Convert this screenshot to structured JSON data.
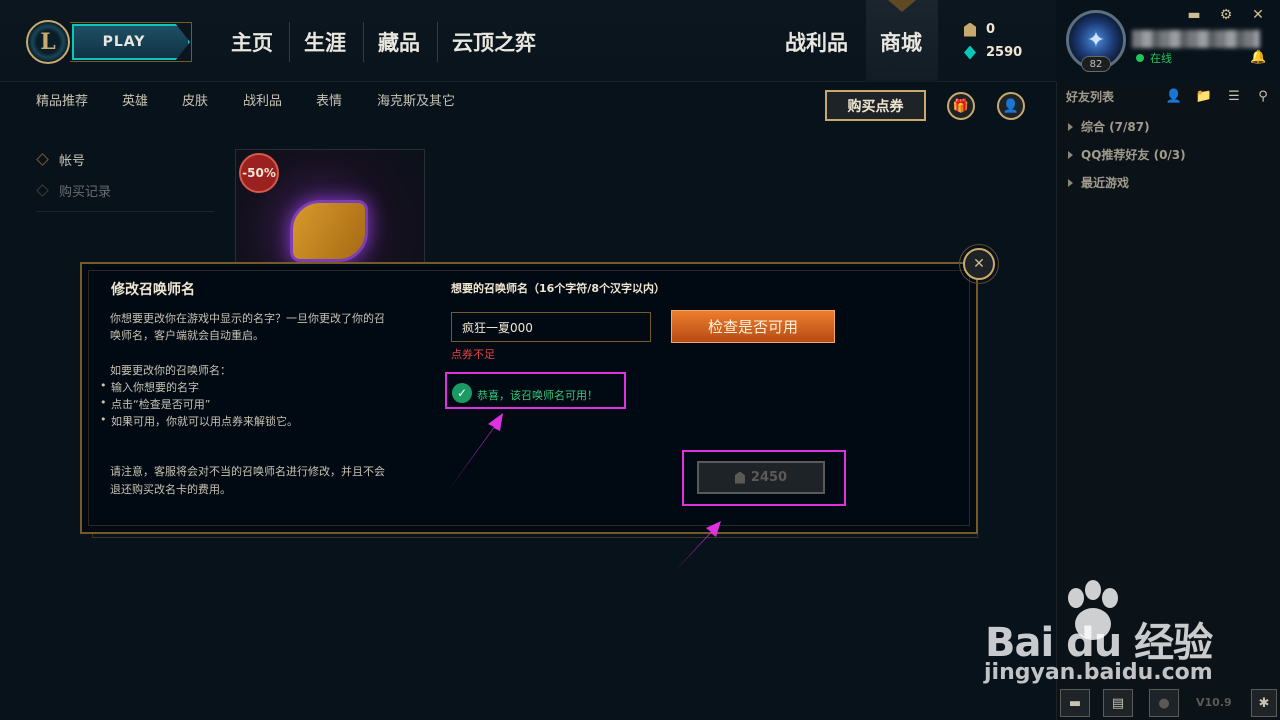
{
  "header": {
    "play_label": "PLAY",
    "nav": [
      {
        "label": "主页"
      },
      {
        "label": "生涯"
      },
      {
        "label": "藏品"
      },
      {
        "label": "云顶之弈"
      }
    ],
    "loot_label": "战利品",
    "store_label": "商城",
    "currency": {
      "rp": "0",
      "blue_essence": "2590"
    },
    "profile": {
      "level": "82",
      "status": "在线"
    }
  },
  "subnav": {
    "items": [
      "精品推荐",
      "英雄",
      "皮肤",
      "战利品",
      "表情",
      "海克斯及其它"
    ],
    "buy_rp_label": "购买点券"
  },
  "side_menu": {
    "items": [
      "帐号",
      "购买记录"
    ]
  },
  "product": {
    "discount": "-50%"
  },
  "friends": {
    "title": "好友列表",
    "groups": [
      {
        "label": "综合 (7/87)"
      },
      {
        "label": "QQ推荐好友 (0/3)"
      },
      {
        "label": "最近游戏"
      }
    ]
  },
  "bottom": {
    "version": "V10.9"
  },
  "modal": {
    "title": "修改召唤师名",
    "intro_line1": "你想要更改你在游戏中显示的名字？一旦你更改了你的召",
    "intro_line2": "唤师名，客户端就会自动重启。",
    "steps_title": "如要更改你的召唤师名：",
    "steps": [
      "输入你想要的名字",
      "点击“检查是否可用”",
      "如果可用，你就可以用点券来解锁它。"
    ],
    "note_line1": "请注意，客服将会对不当的召唤师名进行修改，并且不会",
    "note_line2": "退还购买改名卡的费用。",
    "input_label": "想要的召唤师名（16个字符/8个汉字以内）",
    "input_value": "疯狂一夏000",
    "check_button": "检查是否可用",
    "error_text": "点券不足",
    "success_text": "恭喜，该召唤师名可用！",
    "unlock_price": "2450"
  },
  "watermark": {
    "logo_text": "Bai du 经验",
    "url": "jingyan.baidu.com"
  }
}
